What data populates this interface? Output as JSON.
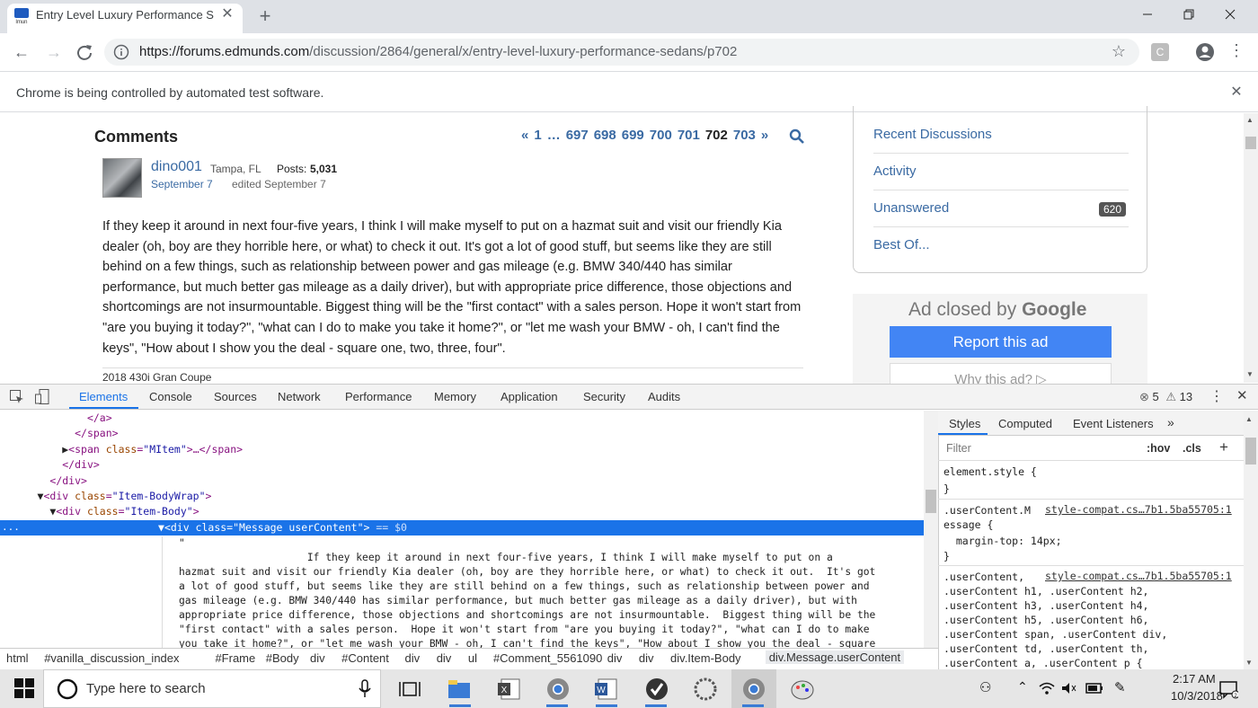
{
  "browser": {
    "tab_title": "Entry Level Luxury Performance S",
    "tab_favicon": "edmunds-favicon",
    "url_host": "https://forums.edmunds.com",
    "url_path": "/discussion/2864/general/x/entry-level-luxury-performance-sedans/p702",
    "infobar_text": "Chrome is being controlled by automated test software."
  },
  "page": {
    "comments_title": "Comments",
    "pager": {
      "prev": "«",
      "items": [
        "1",
        "…",
        "697",
        "698",
        "699",
        "700",
        "701",
        "702",
        "703"
      ],
      "current": "702",
      "next": "»"
    },
    "comment": {
      "username": "dino001",
      "location": "Tampa, FL",
      "posts_label": "Posts:",
      "posts_count": "5,031",
      "date": "September 7",
      "edited": "edited September 7",
      "body": "If they keep it around in next four-five years, I think I will make myself to put on a hazmat suit and visit our friendly Kia dealer (oh, boy are they horrible here, or what) to check it out. It's got a lot of good stuff, but seems like they are still behind on a few things, such as relationship between power and gas mileage (e.g. BMW 340/440 has similar performance, but much better gas mileage as a daily driver), but with appropriate price difference, those objections and shortcomings are not insurmountable. Biggest thing will be the \"first contact\" with a sales person. Hope it won't start from \"are you buying it today?\", \"what can I do to make you take it home?\", or \"let me wash your BMW - oh, I can't find the keys\", \"How about I show you the deal - square one, two, three, four\".",
      "signature": "2018 430i Gran Coupe"
    },
    "sidebar": {
      "links": [
        "Recent Discussions",
        "Activity",
        "Unanswered",
        "Best Of..."
      ],
      "unanswered_count": "620"
    },
    "ad": {
      "closed_text_prefix": "Ad closed by ",
      "closed_text_brand": "Google",
      "report_label": "Report this ad",
      "why_label": "Why this ad? ▷"
    }
  },
  "devtools": {
    "tabs": [
      "Elements",
      "Console",
      "Sources",
      "Network",
      "Performance",
      "Memory",
      "Application",
      "Security",
      "Audits"
    ],
    "active_tab": "Elements",
    "errors": "5",
    "warnings": "13",
    "dom_lines": [
      {
        "indent": "              ",
        "html": "</a>"
      },
      {
        "indent": "            ",
        "html": "</span>"
      },
      {
        "indent": "          ▶",
        "html": "<span class=\"MItem\">…</span>"
      },
      {
        "indent": "          ",
        "html": "</div>"
      },
      {
        "indent": "        ",
        "html": "</div>"
      },
      {
        "indent": "      ▼",
        "html": "<div class=\"Item-BodyWrap\">"
      },
      {
        "indent": "        ▼",
        "html": "<div class=\"Item-Body\">"
      }
    ],
    "selected_line": "<div class=\"Message userContent\">",
    "selected_suffix": " == $0",
    "selected_prefix": "...",
    "text_node_open": "\"",
    "text_node": "                     If they keep it around in next four-five years, I think I will make myself to put on a\nhazmat suit and visit our friendly Kia dealer (oh, boy are they horrible here, or what) to check it out.  It's got\na lot of good stuff, but seems like they are still behind on a few things, such as relationship between power and\ngas mileage (e.g. BMW 340/440 has similar performance, but much better gas mileage as a daily driver), but with\nappropriate price difference, those objections and shortcomings are not insurmountable.  Biggest thing will be the\n\"first contact\" with a sales person.  Hope it won't start from \"are you buying it today?\", \"what can I do to make\nyou take it home?\", or \"let me wash your BMW - oh, I can't find the keys\", \"How about I show you the deal - square",
    "breadcrumbs": [
      "html",
      "#vanilla_discussion_index",
      "#Frame",
      "#Body",
      "div",
      "#Content",
      "div",
      "div",
      "ul",
      "#Comment_5561090",
      "div",
      "div",
      "div.Item-Body",
      "div.Message.userContent"
    ],
    "styles_tabs": [
      "Styles",
      "Computed",
      "Event Listeners",
      "»"
    ],
    "filter_placeholder": "Filter",
    "hov": ":hov",
    "cls": ".cls",
    "add": "+",
    "rules": {
      "element_style": "element.style {",
      "close": "}",
      "rule1_selector_a": ".userContent.M",
      "rule1_selector_b": "essage {",
      "rule1_source": "style-compat.cs…7b1.5ba55705:1",
      "rule1_decl": "  margin-top: 14px;",
      "rule2_selector": ".userContent,",
      "rule2_source": "style-compat.cs…7b1.5ba55705:1",
      "rule2_lines": [
        ".userContent h1, .userContent h2,",
        ".userContent h3, .userContent h4,",
        ".userContent h5, .userContent h6,",
        ".userContent span, .userContent div,",
        ".userContent td, .userContent th,",
        ".userContent a, .userContent p {"
      ]
    }
  },
  "taskbar": {
    "search_placeholder": "Type here to search",
    "time": "2:17 AM",
    "date": "10/3/2018"
  },
  "colors": {
    "accent": "#1a73e8",
    "link": "#3a6aa3",
    "ad_button": "#4285f4"
  }
}
